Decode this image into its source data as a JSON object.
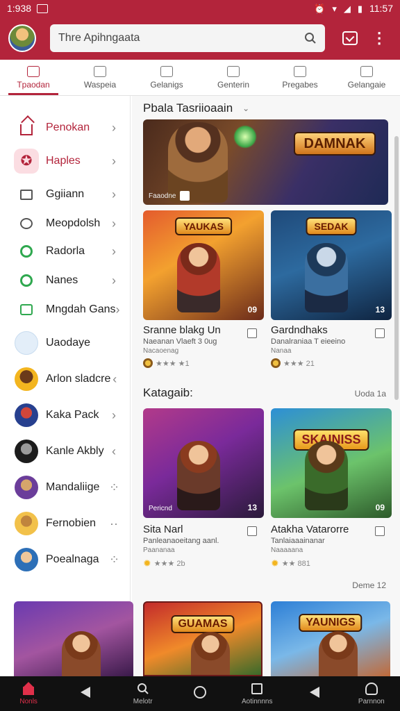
{
  "status_bar": {
    "time_left": "1:938",
    "time_right": "11:57"
  },
  "header": {
    "search_placeholder": "Thre Apihngaata"
  },
  "tabs": [
    {
      "label": "Tpaodan",
      "active": true
    },
    {
      "label": "Waspeia"
    },
    {
      "label": "Gelanigs"
    },
    {
      "label": "Genterin"
    },
    {
      "label": "Pregabes"
    },
    {
      "label": "Gelangaie"
    }
  ],
  "sidebar": {
    "items": [
      {
        "label": "Penokan",
        "icon": "home-icon",
        "chevron": "›"
      },
      {
        "label": "Haples",
        "icon": "star-icon",
        "chevron": "›"
      },
      {
        "label": "Ggiiann",
        "icon": "box-icon",
        "chevron": "›"
      },
      {
        "label": "Meopdolsh",
        "icon": "bubble-icon",
        "chevron": "›"
      },
      {
        "label": "Radorla",
        "icon": "spiral-icon",
        "chevron": "›"
      },
      {
        "label": "Nanes",
        "icon": "spiral-icon",
        "chevron": "›"
      },
      {
        "label": "Mngdah Gans",
        "icon": "chat-icon",
        "chevron": "›"
      },
      {
        "label": "Uaodaye",
        "icon": "house-avatar",
        "chevron": ""
      },
      {
        "label": "Arlon sladcre",
        "icon": "avatar",
        "chevron": "‹"
      },
      {
        "label": "Kaka Pack",
        "icon": "avatar",
        "chevron": "›"
      },
      {
        "label": "Kanle Akbly",
        "icon": "avatar",
        "chevron": "‹"
      },
      {
        "label": "Mandaliige",
        "icon": "avatar",
        "chevron": "⁘"
      },
      {
        "label": "Fernobien",
        "icon": "avatar",
        "chevron": "··"
      },
      {
        "label": "Poealnaga",
        "icon": "avatar",
        "chevron": "⁘"
      }
    ]
  },
  "main": {
    "section1_title": "Pbala Tasriioaain",
    "hero": {
      "banner": "DAMNAK",
      "caption": "Faaodne"
    },
    "cards_row1": [
      {
        "banner": "YAUKAS",
        "number": "09",
        "title": "Sranne blakg Un",
        "subtitle": "Naeanan Vlaeft 3 0ug",
        "meta": "Nacaoenag",
        "rating": "★★★ ★1"
      },
      {
        "banner": "SEDAK",
        "number": "13",
        "title": "Gardndhaks",
        "subtitle": "Danalraniaa T eieeino",
        "meta": "Nanaa",
        "rating": "★★★ 21"
      }
    ],
    "section2_title": "Katagaib:",
    "section2_more": "Uoda 1a",
    "cards_row2": [
      {
        "banner": "",
        "number": "13",
        "badge": "Pericnd",
        "title": "Sita Narl",
        "subtitle": "Panleanaoeitang aanl.",
        "meta": "Paananaa",
        "rating": "★★★ 2b"
      },
      {
        "banner": "SKAINISS",
        "number": "09",
        "title": "Atakha Vatarorre",
        "subtitle": "Tanlaiaaainanar",
        "meta": "Naaaaana",
        "rating": "★★ 881"
      }
    ],
    "section3_more": "Deme 12",
    "bottom_tiles": [
      {
        "banner": ""
      },
      {
        "banner": "GUAMAS"
      },
      {
        "banner": "YAUNIGS"
      }
    ]
  },
  "bottom_nav": [
    {
      "label": "Nonls",
      "active": true
    },
    {
      "label": ""
    },
    {
      "label": "Melotr"
    },
    {
      "label": ""
    },
    {
      "label": "Aotinnnns"
    },
    {
      "label": ""
    },
    {
      "label": "Parnnon"
    }
  ],
  "colors": {
    "brand": "#b3243b",
    "accent_active": "#e0304a"
  }
}
